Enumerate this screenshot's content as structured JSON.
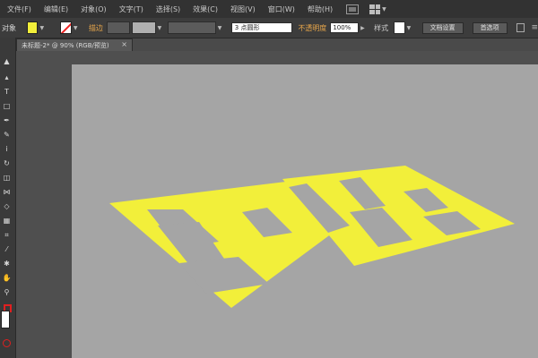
{
  "menubar": {
    "items": [
      "文件(F)",
      "编辑(E)",
      "对象(O)",
      "文字(T)",
      "选择(S)",
      "效果(C)",
      "视图(V)",
      "窗口(W)",
      "帮助(H)"
    ]
  },
  "controlbar": {
    "selection_label": "对象",
    "fill_color": "#f2ef3a",
    "stroke_label": "描边",
    "brush_value": "3 点圆形",
    "opacity_label": "不透明度",
    "opacity_value": "100%",
    "style_label": "样式",
    "doc_setup_button": "文档设置",
    "preferences_button": "首选项"
  },
  "tab": {
    "title": "未标题-2* @ 90% (RGB/预览)",
    "close": "×"
  },
  "artwork": {
    "text": "凹陷",
    "color": "#f2ef3a"
  }
}
